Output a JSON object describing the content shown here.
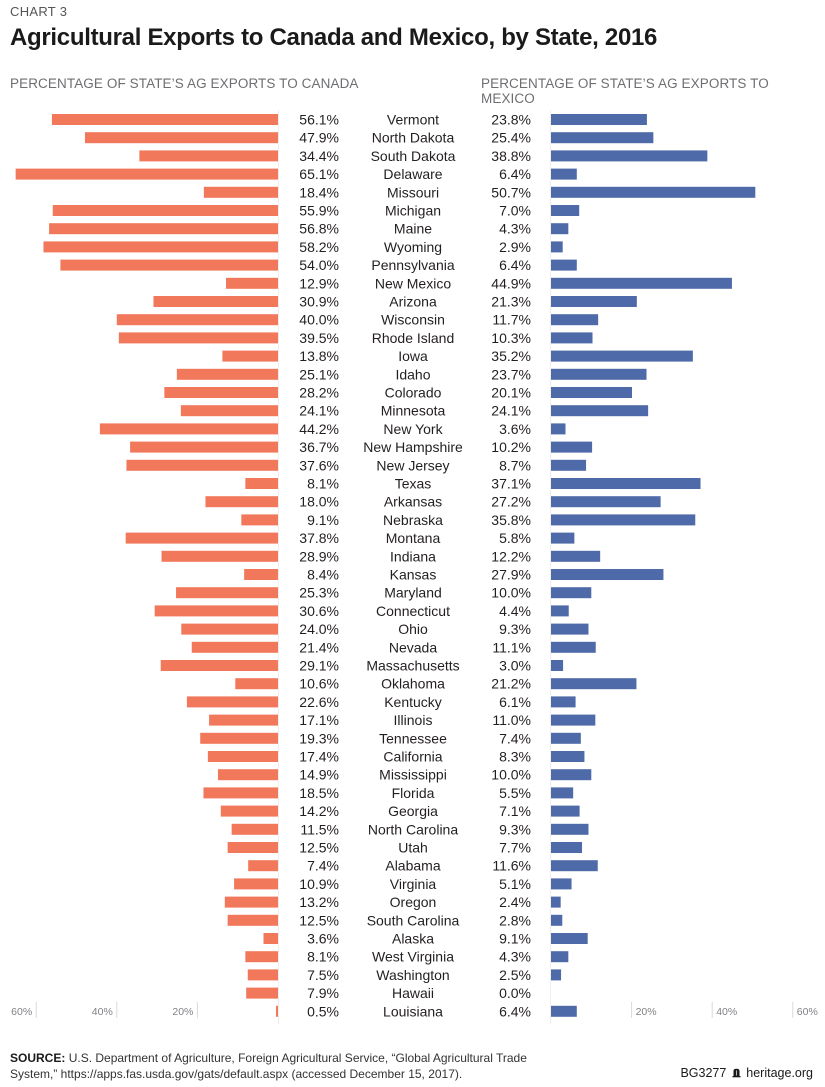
{
  "header": {
    "chart_label": "CHART 3",
    "title": "Agricultural Exports to Canada and Mexico, by State, 2016"
  },
  "footer": {
    "source_label": "SOURCE:",
    "source_text": "U.S. Department of Agriculture, Foreign Agricultural Service, “Global Agricultural Trade System,” https://apps.fas.usda.gov/gats/default.aspx (accessed December 15, 2017).",
    "report_id": "BG3277",
    "site": "heritage.org",
    "logo_icon": "liberty-bell-icon"
  },
  "colors": {
    "canada": "#f2785c",
    "mexico": "#4f6aa8",
    "text": "#231f20",
    "axis": "#d9d9d9",
    "tick_label": "#808285"
  },
  "chart_data": {
    "type": "bar",
    "orientation": "horizontal-butterfly",
    "title": "Agricultural Exports to Canada and Mexico, by State, 2016",
    "series": [
      {
        "name": "Canada",
        "header": "PERCENTAGE OF STATE’S AG EXPORTS TO CANADA",
        "values": [
          56.1,
          47.9,
          34.4,
          65.1,
          18.4,
          55.9,
          56.8,
          58.2,
          54.0,
          12.9,
          30.9,
          40.0,
          39.5,
          13.8,
          25.1,
          28.2,
          24.1,
          44.2,
          36.7,
          37.6,
          8.1,
          18.0,
          9.1,
          37.8,
          28.9,
          8.4,
          25.3,
          30.6,
          24.0,
          21.4,
          29.1,
          10.6,
          22.6,
          17.1,
          19.3,
          17.4,
          14.9,
          18.5,
          14.2,
          11.5,
          12.5,
          7.4,
          10.9,
          13.2,
          12.5,
          3.6,
          8.1,
          7.5,
          7.9,
          0.5
        ],
        "direction": "left"
      },
      {
        "name": "Mexico",
        "header": "PERCENTAGE OF STATE’S AG EXPORTS TO MEXICO",
        "values": [
          23.8,
          25.4,
          38.8,
          6.4,
          50.7,
          7.0,
          4.3,
          2.9,
          6.4,
          44.9,
          21.3,
          11.7,
          10.3,
          35.2,
          23.7,
          20.1,
          24.1,
          3.6,
          10.2,
          8.7,
          37.1,
          27.2,
          35.8,
          5.8,
          12.2,
          27.9,
          10.0,
          4.4,
          9.3,
          11.1,
          3.0,
          21.2,
          6.1,
          11.0,
          7.4,
          8.3,
          10.0,
          5.5,
          7.1,
          9.3,
          7.7,
          11.6,
          5.1,
          2.4,
          2.8,
          9.1,
          4.3,
          2.5,
          0.0,
          6.4
        ],
        "direction": "right"
      }
    ],
    "categories": [
      "Vermont",
      "North Dakota",
      "South Dakota",
      "Delaware",
      "Missouri",
      "Michigan",
      "Maine",
      "Wyoming",
      "Pennsylvania",
      "New Mexico",
      "Arizona",
      "Wisconsin",
      "Rhode Island",
      "Iowa",
      "Idaho",
      "Colorado",
      "Minnesota",
      "New York",
      "New Hampshire",
      "New Jersey",
      "Texas",
      "Arkansas",
      "Nebraska",
      "Montana",
      "Indiana",
      "Kansas",
      "Maryland",
      "Connecticut",
      "Ohio",
      "Nevada",
      "Massachusetts",
      "Oklahoma",
      "Kentucky",
      "Illinois",
      "Tennessee",
      "California",
      "Mississippi",
      "Florida",
      "Georgia",
      "North Carolina",
      "Utah",
      "Alabama",
      "Virginia",
      "Oregon",
      "South Carolina",
      "Alaska",
      "West Virginia",
      "Washington",
      "Hawaii",
      "Louisiana"
    ],
    "xlim": [
      0,
      60
    ],
    "ticks": [
      20,
      40,
      60
    ],
    "tick_labels": [
      "20%",
      "40%",
      "60%"
    ],
    "value_format": "percent-1dp",
    "grid": false,
    "legend": "column headers at top"
  }
}
